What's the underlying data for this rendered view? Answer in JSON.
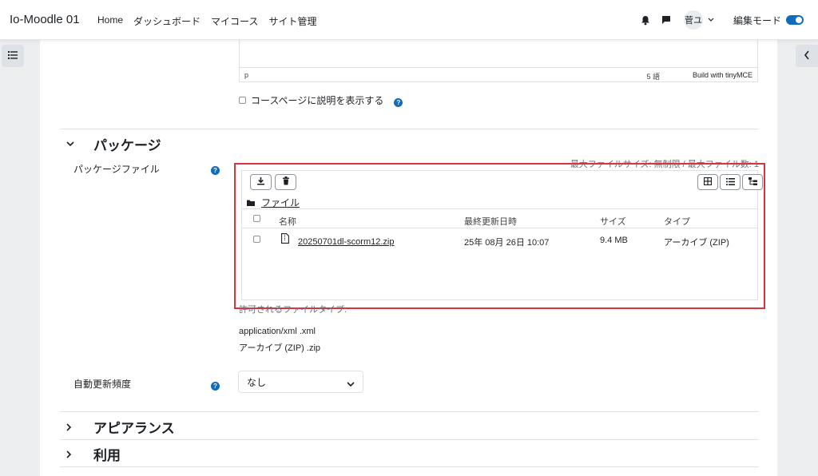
{
  "navbar": {
    "brand": "Io-Moodle 01",
    "links": [
      "Home",
      "ダッシュボード",
      "マイコース",
      "サイト管理"
    ],
    "user_initials": "菅ユ",
    "edit_mode_label": "編集モード",
    "edit_mode_on": true
  },
  "editor": {
    "path": "p",
    "word_count": "5 語",
    "build_with": "Build with tinyMCE"
  },
  "show_description_label": "コースページに説明を表示する",
  "sections": {
    "package": "パッケージ",
    "appearance": "アピアランス",
    "availability": "利用"
  },
  "package_file": {
    "label": "パッケージファイル",
    "max_size_text": "最大ファイルサイズ: 無制限 / 最大ファイル数: 1",
    "folder": "ファイル",
    "columns": [
      "名称",
      "最終更新日時",
      "サイズ",
      "タイプ"
    ],
    "files": [
      {
        "name": "20250701dl-scorm12.zip",
        "modified": "25年 08月 26日 10:07",
        "size": "9.4 MB",
        "type": "アーカイブ (ZIP)"
      }
    ],
    "allowed_types_label": "許可されるファイルタイプ:",
    "allowed_types": [
      "application/xml .xml",
      "アーカイブ (ZIP) .zip"
    ]
  },
  "auto_update": {
    "label": "自動更新頻度",
    "value": "なし"
  },
  "colors": {
    "accent": "#0f6cbf",
    "highlight_border": "#d9343e",
    "page_bg": "#eceef0"
  }
}
